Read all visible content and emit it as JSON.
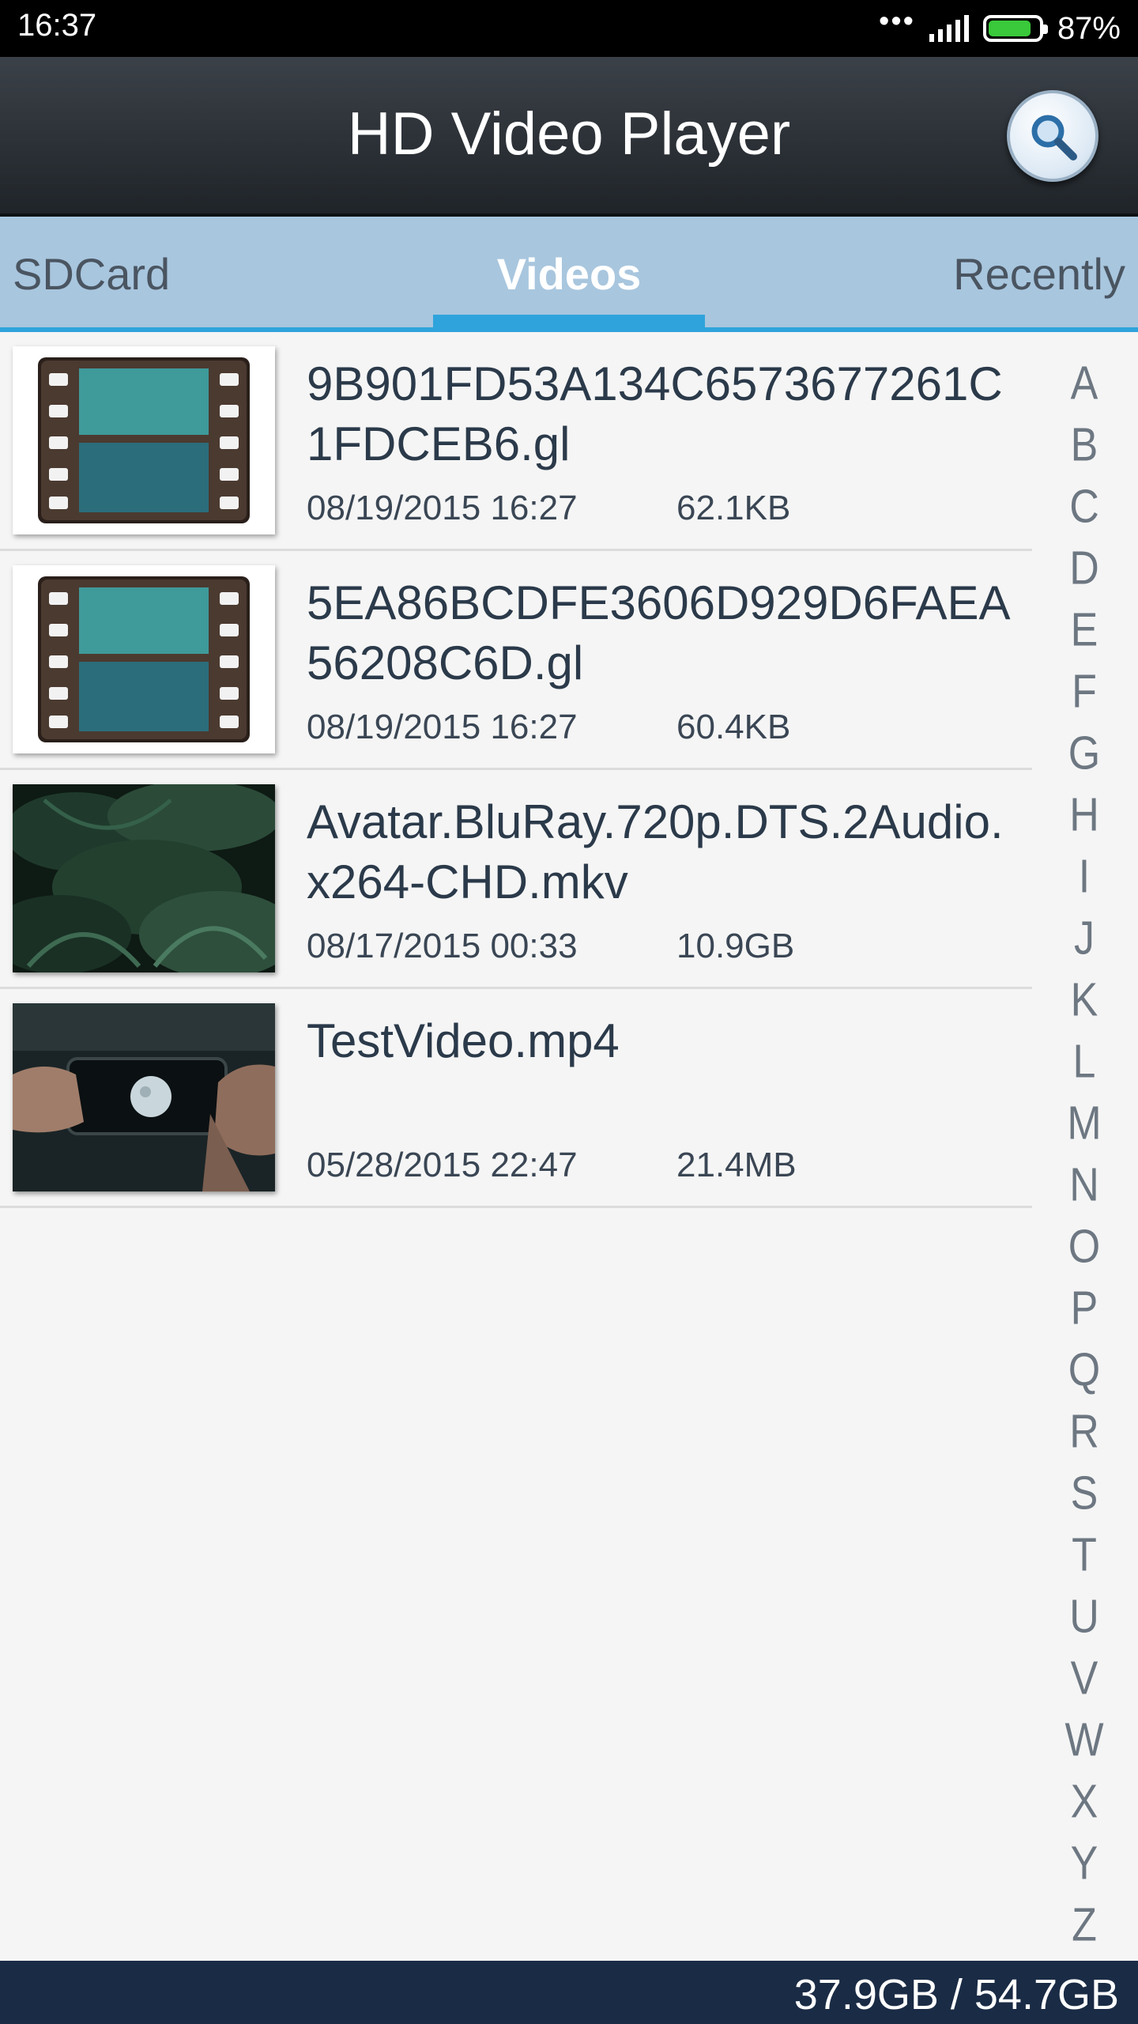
{
  "status_bar": {
    "time": "16:37",
    "dots": "•••",
    "battery_percent": "87%",
    "battery_level": 0.87
  },
  "app": {
    "title": "HD Video Player"
  },
  "tabs": [
    {
      "label": "SDCard",
      "selected": false
    },
    {
      "label": "Videos",
      "selected": true
    },
    {
      "label": "Recently",
      "selected": false
    }
  ],
  "videos": [
    {
      "name": "9B901FD53A134C6573677261C1FDCEB6.gl",
      "date": "08/19/2015 16:27",
      "size": "62.1KB",
      "thumbnail": "film-icon"
    },
    {
      "name": "5EA86BCDFE3606D929D6FAEA56208C6D.gl",
      "date": "08/19/2015 16:27",
      "size": "60.4KB",
      "thumbnail": "film-icon"
    },
    {
      "name": "Avatar.BluRay.720p.DTS.2Audio.x264-CHD.mkv",
      "date": "08/17/2015 00:33",
      "size": "10.9GB",
      "thumbnail": "jungle-foliage"
    },
    {
      "name": "TestVideo.mp4",
      "date": "05/28/2015 22:47",
      "size": "21.4MB",
      "thumbnail": "hands-holding-phone"
    }
  ],
  "alphabet": [
    "A",
    "B",
    "C",
    "D",
    "E",
    "F",
    "G",
    "H",
    "I",
    "J",
    "K",
    "L",
    "M",
    "N",
    "O",
    "P",
    "Q",
    "R",
    "S",
    "T",
    "U",
    "V",
    "W",
    "X",
    "Y",
    "Z"
  ],
  "footer": {
    "storage": "37.9GB / 54.7GB"
  },
  "colors": {
    "tab_bar": "#a8c6de",
    "tab_accent": "#2fa3dc",
    "footer": "#1a2b45",
    "battery": "#39c93a"
  }
}
